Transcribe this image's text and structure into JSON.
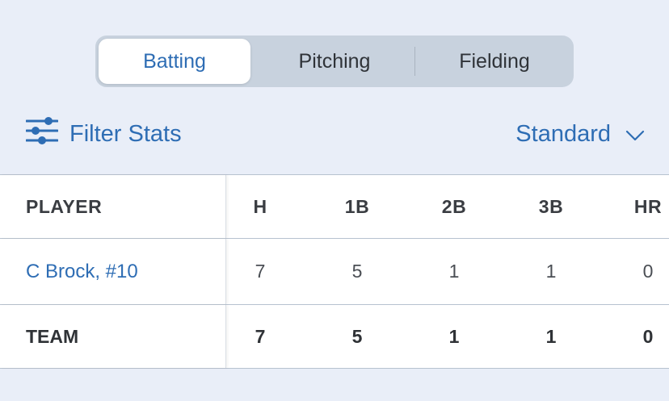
{
  "tabs": [
    {
      "label": "Batting",
      "active": true
    },
    {
      "label": "Pitching",
      "active": false
    },
    {
      "label": "Fielding",
      "active": false
    }
  ],
  "toolbar": {
    "filter_label": "Filter Stats",
    "filter_icon": "sliders-icon",
    "view_label": "Standard",
    "view_icon": "chevron-down-icon"
  },
  "table": {
    "columns": [
      "PLAYER",
      "H",
      "1B",
      "2B",
      "3B",
      "HR"
    ],
    "rows": [
      {
        "player": "C Brock, #10",
        "values": [
          "7",
          "5",
          "1",
          "1",
          "0"
        ]
      }
    ],
    "team": {
      "label": "TEAM",
      "values": [
        "7",
        "5",
        "1",
        "1",
        "0"
      ]
    }
  },
  "colors": {
    "accent": "#2e6db4",
    "background": "#e9eef8",
    "segment_bg": "#c8d2de"
  }
}
